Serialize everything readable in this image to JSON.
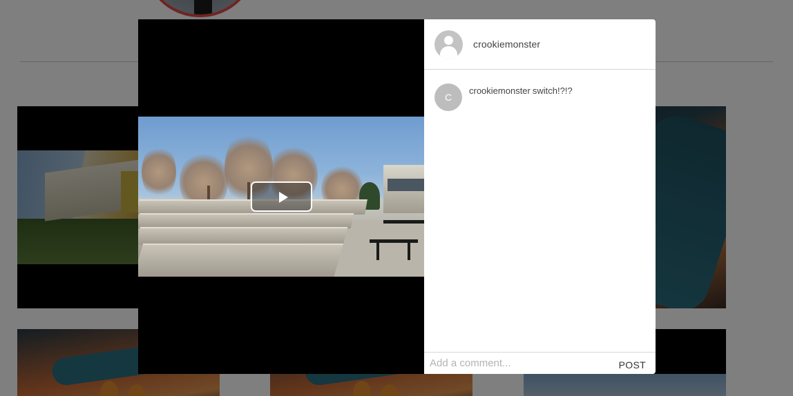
{
  "modal": {
    "header": {
      "username": "crookiemonster",
      "avatar_icon": "default-user-icon"
    },
    "media": {
      "play_icon": "play-icon"
    },
    "comments": [
      {
        "avatar_initial": "C",
        "author": "crookiemonster",
        "text": "switch!?!?"
      }
    ],
    "footer": {
      "input_placeholder": "Add a comment...",
      "input_value": "",
      "post_label": "POST"
    }
  },
  "colors": {
    "overlay": "#808080",
    "panel_bg": "#ffffff",
    "avatar_gray": "#c3c3c3",
    "profile_ring": "#e04848"
  }
}
